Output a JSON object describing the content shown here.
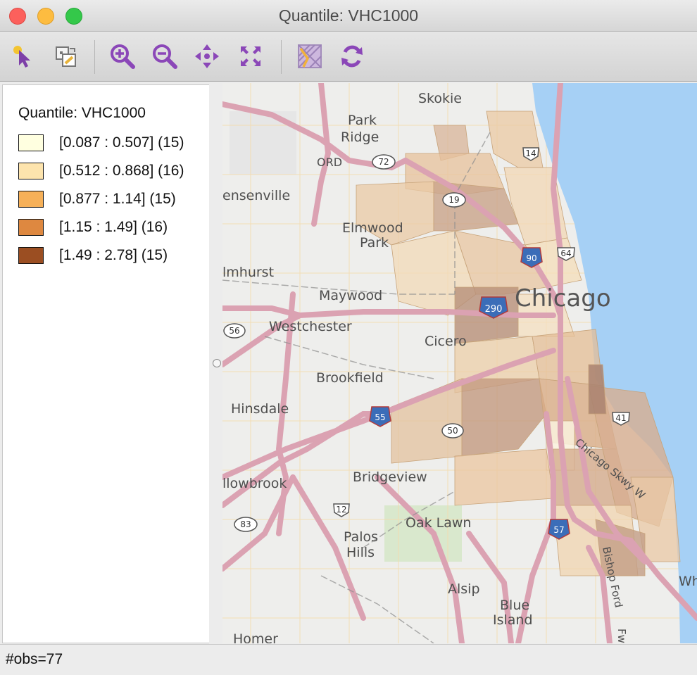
{
  "window": {
    "title": "Quantile: VHC1000"
  },
  "toolbar": {
    "buttons": [
      {
        "icon": "select-pointer-icon"
      },
      {
        "icon": "copy-map-icon"
      },
      {
        "icon": "zoom-in-icon"
      },
      {
        "icon": "zoom-out-icon"
      },
      {
        "icon": "pan-icon"
      },
      {
        "icon": "full-extent-icon"
      },
      {
        "icon": "basemap-toggle-icon"
      },
      {
        "icon": "refresh-icon"
      }
    ],
    "accent_color": "#8b47b8"
  },
  "legend": {
    "title": "Quantile: VHC1000",
    "classes": [
      {
        "label": "[0.087 : 0.507] (15)",
        "color": "#ffffe0"
      },
      {
        "label": "[0.512 : 0.868] (16)",
        "color": "#fde4ad"
      },
      {
        "label": "[0.877 : 1.14] (15)",
        "color": "#f6b058"
      },
      {
        "label": "[1.15 : 1.49] (16)",
        "color": "#de8840"
      },
      {
        "label": "[1.49 : 2.78] (15)",
        "color": "#9b4e22"
      }
    ]
  },
  "map": {
    "places": [
      "Skokie",
      "Park",
      "Ridge",
      "ORD",
      "ensenville",
      "Elmwood",
      "Park",
      "lmhurst",
      "Maywood",
      "Chicago",
      "Westchester",
      "Cicero",
      "Brookfield",
      "Hinsdale",
      "llowbrook",
      "Bridgeview",
      "Oak Lawn",
      "Palos",
      "Hills",
      "Alsip",
      "Blue",
      "Island",
      "Homer",
      "Wh",
      "Chicago Skwy W",
      "Bishop Ford",
      "Fw"
    ],
    "shields": [
      "72",
      "14",
      "19",
      "90",
      "64",
      "290",
      "56",
      "55",
      "50",
      "41",
      "57",
      "12",
      "83"
    ],
    "water_color": "#a6d0f5"
  },
  "status": {
    "text": "#obs=77"
  }
}
